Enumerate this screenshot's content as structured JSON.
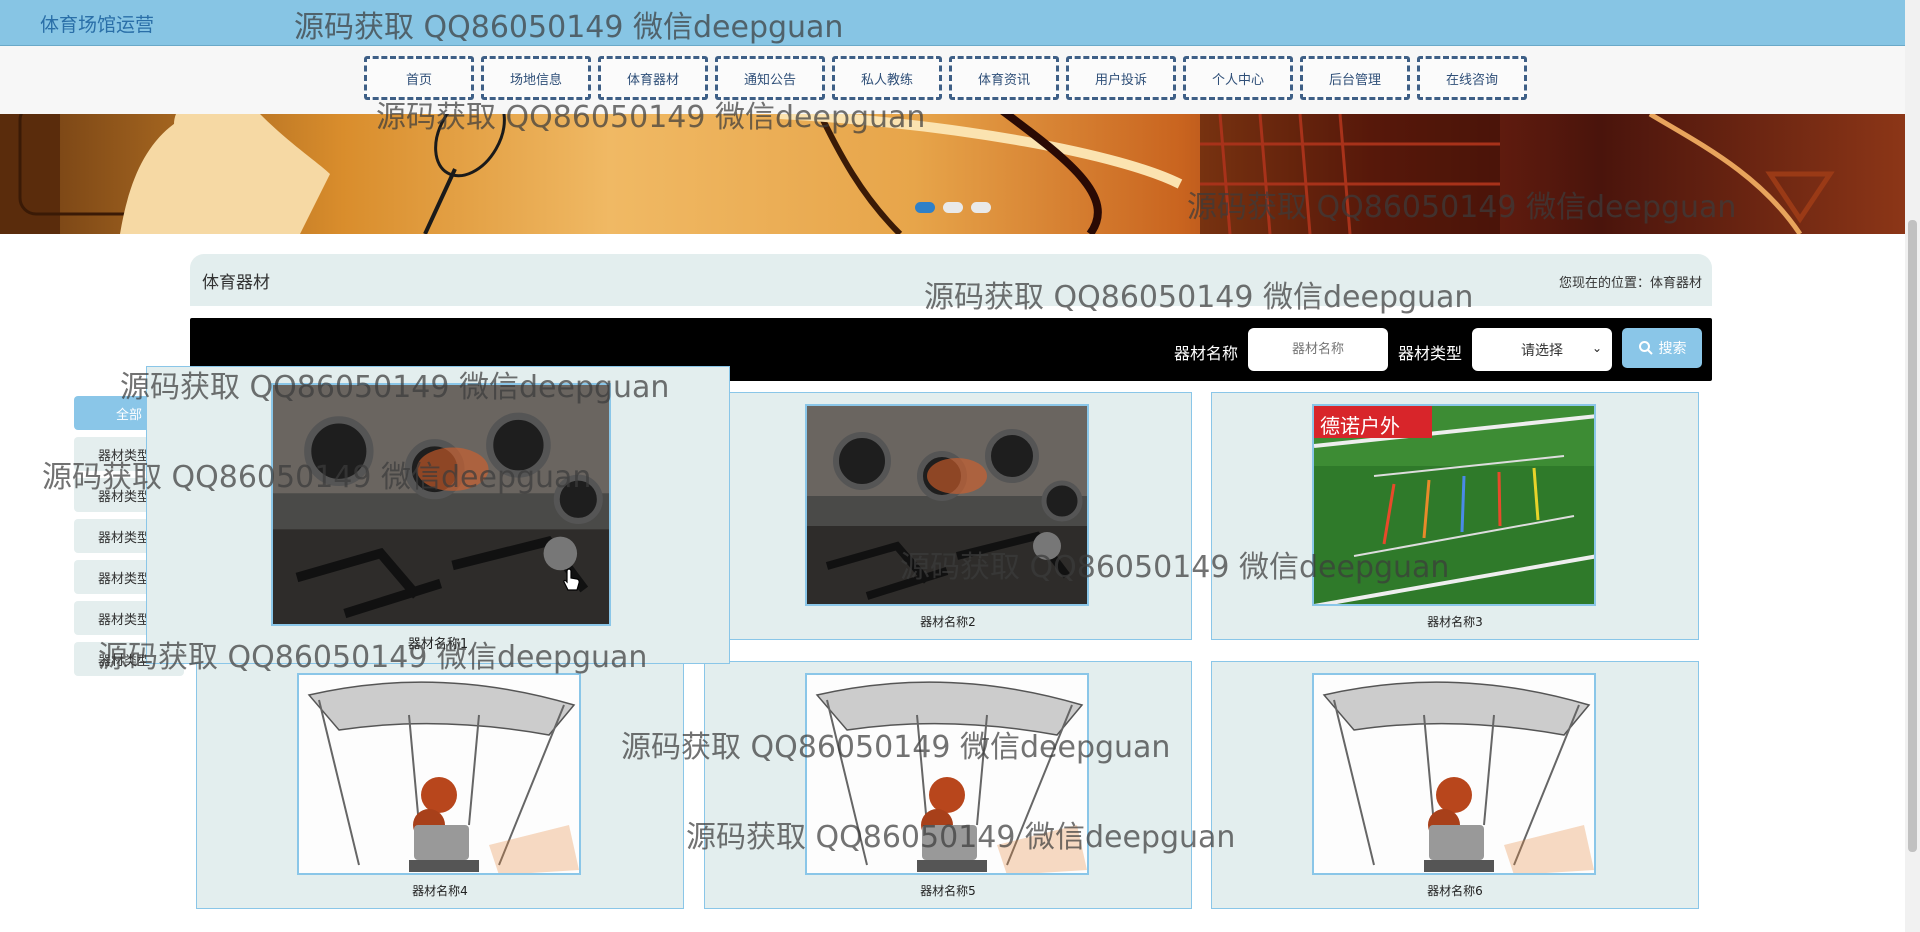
{
  "app": {
    "title": "体育场馆运营"
  },
  "nav": {
    "items": [
      "首页",
      "场地信息",
      "体育器材",
      "通知公告",
      "私人教练",
      "体育资讯",
      "用户投诉",
      "个人中心",
      "后台管理",
      "在线咨询"
    ]
  },
  "banner": {
    "slides": 3,
    "active_slide": 1
  },
  "section": {
    "title": "体育器材",
    "breadcrumb": "您现在的位置：体育器材"
  },
  "search": {
    "name_label": "器材名称",
    "name_placeholder": "器材名称",
    "type_label": "器材类型",
    "type_selected": "请选择",
    "button_label": "搜索"
  },
  "categories": [
    "全部",
    "器材类型",
    "器材类型",
    "器材类型",
    "器材类型",
    "器材类型",
    "器材类型"
  ],
  "items": [
    {
      "name": "器材名称1",
      "image": "gym-tires"
    },
    {
      "name": "器材名称2",
      "image": "gym-tires"
    },
    {
      "name": "器材名称3",
      "image": "agility-ladder",
      "image_text": "德诺户外"
    },
    {
      "name": "器材名称4",
      "image": "basketball-machine"
    },
    {
      "name": "器材名称5",
      "image": "basketball-machine"
    },
    {
      "name": "器材名称6",
      "image": "basketball-machine"
    }
  ],
  "watermark": {
    "text": "源码获取 QQ86050149 微信deepguan"
  },
  "colors": {
    "topbar": "#87c5e4",
    "accent": "#8ac6e8",
    "card_bg": "#e3eeee",
    "nav_border": "#3e5f86"
  }
}
